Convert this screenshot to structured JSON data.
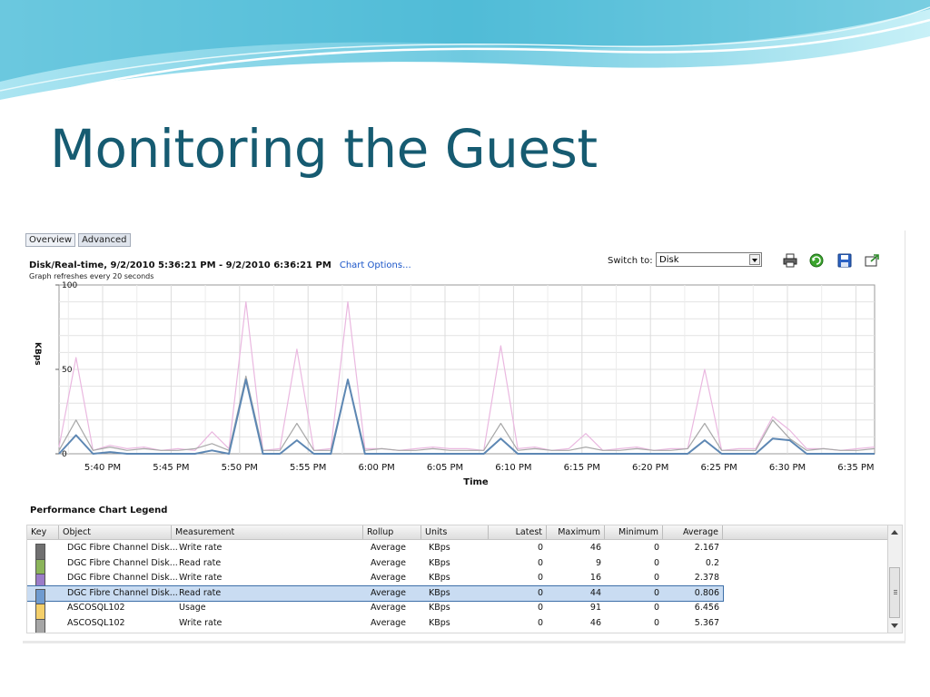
{
  "slide_title": "Monitoring the Guest",
  "tabs": [
    {
      "label": "Overview",
      "active": false
    },
    {
      "label": "Advanced",
      "active": true
    }
  ],
  "header": {
    "title": "Disk/Real-time, 9/2/2010 5:36:21 PM - 9/2/2010 6:36:21 PM",
    "chart_options": "Chart Options...",
    "refresh_note": "Graph refreshes every 20 seconds"
  },
  "switch_to": {
    "label": "Switch to:",
    "value": "Disk"
  },
  "toolbar": {
    "icons": [
      "print-icon",
      "refresh-icon",
      "save-icon",
      "popout-icon"
    ]
  },
  "colors": {
    "title": "#165b71",
    "link": "#1a55c8",
    "wave": "#5cc7dc"
  },
  "chart_data": {
    "type": "line",
    "ylabel": "KBps",
    "xlabel": "Time",
    "ylim": [
      0,
      100
    ],
    "yticks": [
      "100",
      "50",
      "0"
    ],
    "xticks": [
      "5:40 PM",
      "5:45 PM",
      "5:50 PM",
      "5:55 PM",
      "6:00 PM",
      "6:05 PM",
      "6:10 PM",
      "6:15 PM",
      "6:20 PM",
      "6:25 PM",
      "6:30 PM",
      "6:35 PM"
    ],
    "grid": true,
    "series": [
      {
        "color": "#eab8e0",
        "values": [
          4,
          57,
          2,
          5,
          3,
          4,
          2,
          3,
          2,
          13,
          3,
          90,
          2,
          3,
          62,
          2,
          3,
          90,
          3,
          3,
          2,
          3,
          4,
          3,
          3,
          2,
          64,
          3,
          4,
          2,
          3,
          12,
          2,
          3,
          4,
          2,
          3,
          3,
          50,
          2,
          3,
          3,
          22,
          14,
          3,
          3,
          2,
          3,
          4
        ]
      },
      {
        "color": "#a8a8a8",
        "values": [
          2,
          20,
          2,
          4,
          2,
          3,
          2,
          2,
          3,
          6,
          2,
          46,
          2,
          2,
          18,
          2,
          2,
          44,
          2,
          3,
          2,
          2,
          3,
          2,
          2,
          2,
          18,
          2,
          3,
          2,
          2,
          4,
          2,
          2,
          3,
          2,
          2,
          3,
          18,
          2,
          2,
          2,
          20,
          9,
          2,
          3,
          2,
          2,
          3
        ]
      },
      {
        "color": "#5d87b3",
        "values": [
          0,
          11,
          0,
          1,
          0,
          0,
          0,
          0,
          0,
          2,
          0,
          44,
          0,
          0,
          8,
          0,
          0,
          44,
          0,
          0,
          0,
          0,
          0,
          0,
          0,
          0,
          9,
          0,
          0,
          0,
          0,
          0,
          0,
          0,
          0,
          0,
          0,
          0,
          8,
          0,
          0,
          0,
          9,
          8,
          0,
          0,
          0,
          0,
          0
        ]
      }
    ]
  },
  "legend": {
    "title": "Performance Chart Legend",
    "columns": [
      "Key",
      "Object",
      "Measurement",
      "Rollup",
      "Units",
      "Latest",
      "Maximum",
      "Minimum",
      "Average"
    ],
    "rows": [
      {
        "key_color": "#707070",
        "object": "DGC Fibre Channel Disk...",
        "measurement": "Write rate",
        "rollup": "Average",
        "units": "KBps",
        "latest": "0",
        "maximum": "46",
        "minimum": "0",
        "average": "2.167",
        "selected": false
      },
      {
        "key_color": "#8bb45a",
        "object": "DGC Fibre Channel Disk...",
        "measurement": "Read rate",
        "rollup": "Average",
        "units": "KBps",
        "latest": "0",
        "maximum": "9",
        "minimum": "0",
        "average": "0.2",
        "selected": false
      },
      {
        "key_color": "#9b7cc8",
        "object": "DGC Fibre Channel Disk...",
        "measurement": "Write rate",
        "rollup": "Average",
        "units": "KBps",
        "latest": "0",
        "maximum": "16",
        "minimum": "0",
        "average": "2.378",
        "selected": false
      },
      {
        "key_color": "#6f9bd0",
        "object": "DGC Fibre Channel Disk...",
        "measurement": "Read rate",
        "rollup": "Average",
        "units": "KBps",
        "latest": "0",
        "maximum": "44",
        "minimum": "0",
        "average": "0.806",
        "selected": true
      },
      {
        "key_color": "#f4cf6a",
        "object": "ASCOSQL102",
        "measurement": "Usage",
        "rollup": "Average",
        "units": "KBps",
        "latest": "0",
        "maximum": "91",
        "minimum": "0",
        "average": "6.456",
        "selected": false
      },
      {
        "key_color": "#a6a6a6",
        "object": "ASCOSQL102",
        "measurement": "Write rate",
        "rollup": "Average",
        "units": "KBps",
        "latest": "0",
        "maximum": "46",
        "minimum": "0",
        "average": "5.367",
        "selected": false
      }
    ]
  }
}
